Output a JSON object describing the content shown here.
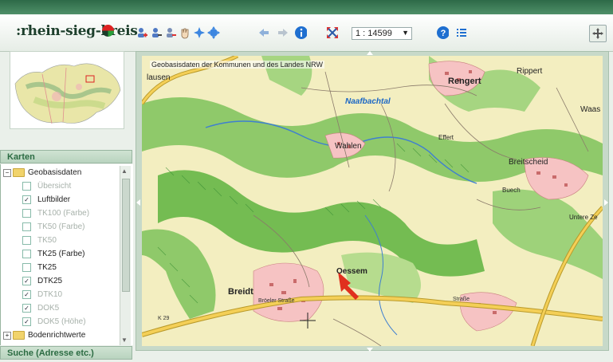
{
  "header": {
    "logo_text": ":rhein-sieg-kreis",
    "scale_value": "1 : 14599"
  },
  "toolbar": {
    "icons": [
      "add-person-icon",
      "person-search-icon",
      "person-remove-icon",
      "hand-pan-icon",
      "zoom-in-icon",
      "zoom-extent-icon",
      "back-arrow-icon",
      "forward-arrow-icon",
      "info-icon",
      "fullscreen-icon",
      "help-icon",
      "list-icon",
      "move-icon"
    ]
  },
  "sidebar": {
    "panel_title": "Karten",
    "tree": [
      {
        "label": "Geobasisdaten",
        "type": "folder",
        "checked": false,
        "active": true
      },
      {
        "label": "Übersicht",
        "type": "layer",
        "checked": false,
        "active": false
      },
      {
        "label": "Luftbilder",
        "type": "layer",
        "checked": true,
        "active": true
      },
      {
        "label": "TK100 (Farbe)",
        "type": "layer",
        "checked": false,
        "active": false
      },
      {
        "label": "TK50 (Farbe)",
        "type": "layer",
        "checked": false,
        "active": false
      },
      {
        "label": "TK50",
        "type": "layer",
        "checked": false,
        "active": false
      },
      {
        "label": "TK25 (Farbe)",
        "type": "layer",
        "checked": false,
        "active": true
      },
      {
        "label": "TK25",
        "type": "layer",
        "checked": false,
        "active": true
      },
      {
        "label": "DTK25",
        "type": "layer",
        "checked": true,
        "active": true
      },
      {
        "label": "DTK10",
        "type": "layer",
        "checked": true,
        "active": false
      },
      {
        "label": "DOK5",
        "type": "layer",
        "checked": true,
        "active": false
      },
      {
        "label": "DOK5 (Höhe)",
        "type": "layer",
        "checked": true,
        "active": false
      },
      {
        "label": "Bodenrichtwerte",
        "type": "folder",
        "checked": false,
        "active": true
      }
    ],
    "search_title": "Suche (Adresse etc.)"
  },
  "map": {
    "title": "Geobasisdaten der Kommunen und des Landes NRW",
    "labels": {
      "rengert": "Rengert",
      "rippert": "Rippert",
      "wahlen": "Wahlen",
      "effert": "Effert",
      "breitscheid": "Breitscheid",
      "buech": "Buech",
      "oessem": "Oessem",
      "breidt": "Breidt",
      "naafbach": "Naafbachtal",
      "lausen": "lausen",
      "untere": "Untere Ze",
      "waas": "Waas"
    },
    "streets": {
      "broelerstr": "Bröeler Straße",
      "strasse": "Straße",
      "kreisstr": "K 29"
    }
  },
  "colors": {
    "accent": "#2b6b42",
    "forest": "#5fb347",
    "road": "#f2c548",
    "arrow": "#e0301e"
  }
}
